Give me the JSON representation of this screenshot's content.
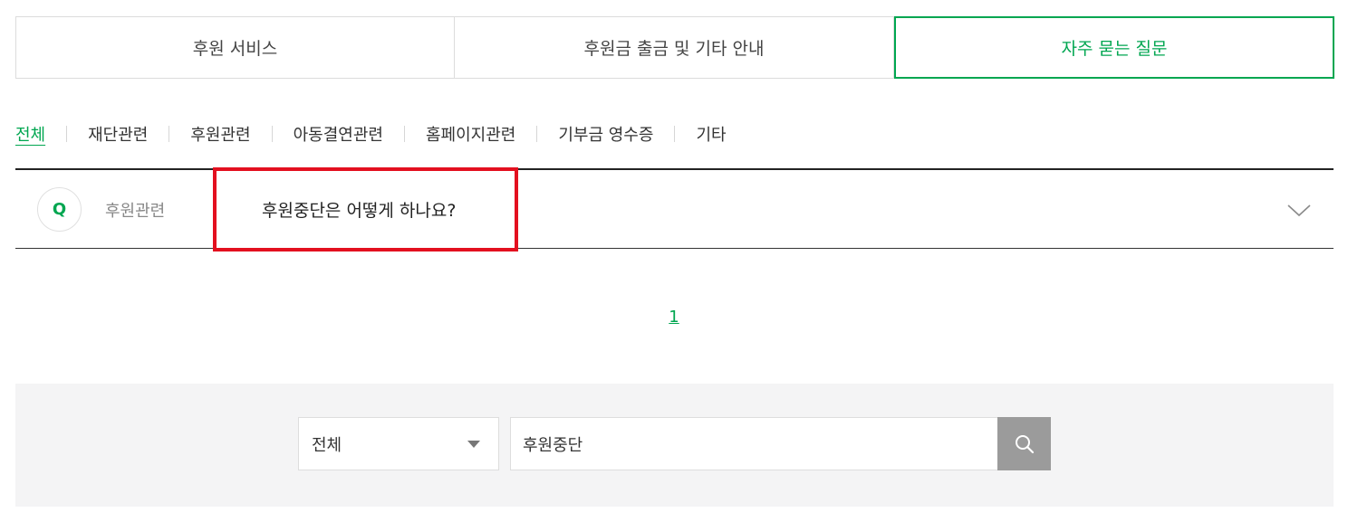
{
  "tabs": [
    {
      "label": "후원 서비스",
      "active": false
    },
    {
      "label": "후원금 출금 및 기타 안내",
      "active": false
    },
    {
      "label": "자주 묻는 질문",
      "active": true
    }
  ],
  "categories": [
    {
      "label": "전체",
      "active": true
    },
    {
      "label": "재단관련",
      "active": false
    },
    {
      "label": "후원관련",
      "active": false
    },
    {
      "label": "아동결연관련",
      "active": false
    },
    {
      "label": "홈페이지관련",
      "active": false
    },
    {
      "label": "기부금 영수증",
      "active": false
    },
    {
      "label": "기타",
      "active": false
    }
  ],
  "faq": {
    "q_label": "Q",
    "category": "후원관련",
    "question": "후원중단은 어떻게 하나요?",
    "expand_icon": "chevron-down-icon"
  },
  "pagination": {
    "current": "1"
  },
  "search": {
    "select_value": "전체",
    "query": "후원중단",
    "button_icon": "search-icon"
  },
  "colors": {
    "accent": "#00a650",
    "highlight": "#e3101f",
    "search_bg": "#f4f4f5",
    "search_button": "#9b9b9b"
  }
}
